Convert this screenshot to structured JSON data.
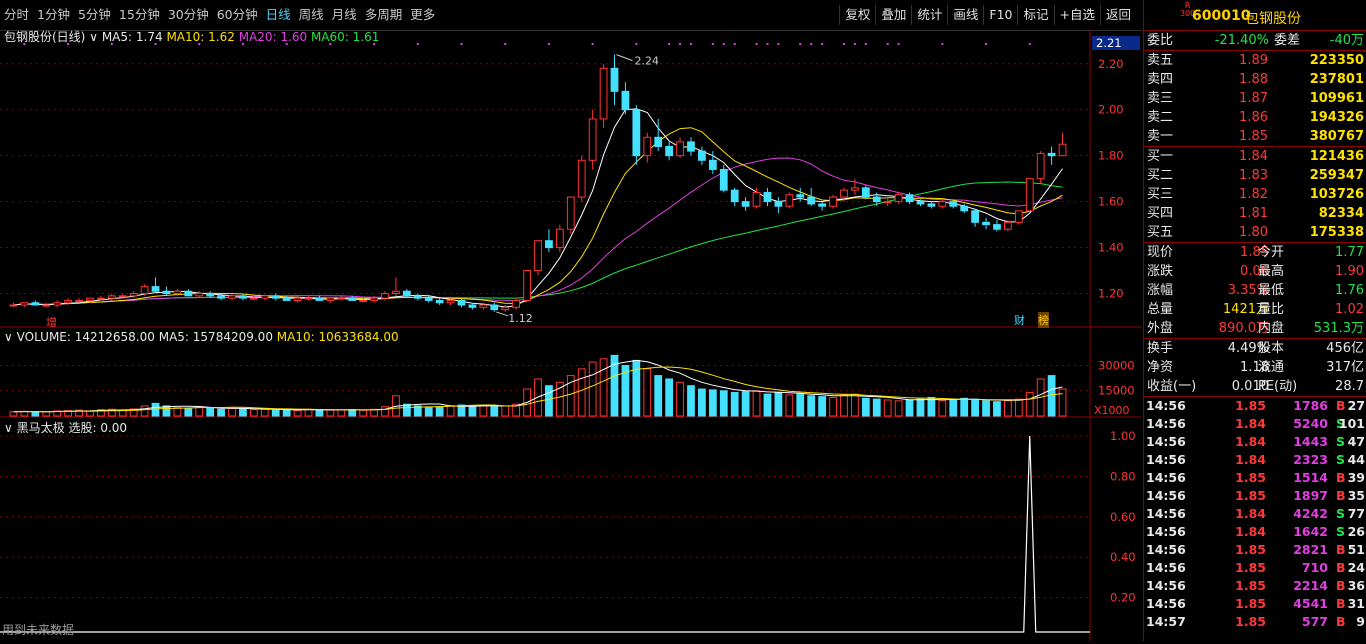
{
  "periods": [
    "分时",
    "1分钟",
    "5分钟",
    "15分钟",
    "30分钟",
    "60分钟",
    "日线",
    "周线",
    "月线",
    "多周期",
    "更多"
  ],
  "active_period": "日线",
  "tools": [
    "复权",
    "叠加",
    "统计",
    "画线",
    "F10",
    "标记",
    "+自选",
    "返回"
  ],
  "main_legend": {
    "title": "包钢股份(日线)",
    "ma5": "MA5: 1.74",
    "ma10": "MA10: 1.62",
    "ma20": "MA20: 1.60",
    "ma60": "MA60: 1.61"
  },
  "price_axis": {
    "top_label": "2.21",
    "ticks": [
      "2.20",
      "2.00",
      "1.80",
      "1.60",
      "1.40",
      "1.20"
    ],
    "high_note": "2.24",
    "low_note": "1.12"
  },
  "volume_legend": {
    "title": "VOLUME: 14212658.00",
    "ma5": "MA5: 15784209.00",
    "ma10": "MA10: 10633684.00"
  },
  "volume_axis": {
    "ticks": [
      "30000",
      "15000"
    ],
    "unit": "X1000"
  },
  "indicator_legend": {
    "title": "黑马太极",
    "value": "选股: 0.00"
  },
  "indicator_axis": [
    "1.00",
    "0.80",
    "0.60",
    "0.40",
    "0.20"
  ],
  "markers": {
    "zeng": "增",
    "cai": "财",
    "bang": "榜"
  },
  "footer_note": "用到未来数据",
  "colors": {
    "up": "#ff3333",
    "down": "#44e0ff",
    "ma5": "#ffffff",
    "ma10": "#ffe100",
    "ma20": "#e23ee2",
    "ma60": "#22e24a",
    "grid": "#8b0000"
  },
  "chart_data": {
    "type": "candlestick",
    "ohlc": [
      [
        1.15,
        1.16,
        1.14,
        1.15
      ],
      [
        1.15,
        1.16,
        1.14,
        1.16
      ],
      [
        1.16,
        1.17,
        1.15,
        1.15
      ],
      [
        1.15,
        1.16,
        1.14,
        1.15
      ],
      [
        1.15,
        1.17,
        1.14,
        1.16
      ],
      [
        1.16,
        1.18,
        1.15,
        1.17
      ],
      [
        1.17,
        1.18,
        1.16,
        1.17
      ],
      [
        1.17,
        1.18,
        1.16,
        1.18
      ],
      [
        1.18,
        1.19,
        1.17,
        1.18
      ],
      [
        1.18,
        1.2,
        1.17,
        1.19
      ],
      [
        1.19,
        1.2,
        1.18,
        1.19
      ],
      [
        1.19,
        1.21,
        1.18,
        1.2
      ],
      [
        1.2,
        1.24,
        1.19,
        1.23
      ],
      [
        1.23,
        1.27,
        1.21,
        1.21
      ],
      [
        1.21,
        1.23,
        1.19,
        1.2
      ],
      [
        1.2,
        1.22,
        1.19,
        1.21
      ],
      [
        1.21,
        1.22,
        1.19,
        1.19
      ],
      [
        1.19,
        1.21,
        1.18,
        1.2
      ],
      [
        1.2,
        1.21,
        1.18,
        1.19
      ],
      [
        1.19,
        1.2,
        1.17,
        1.18
      ],
      [
        1.18,
        1.2,
        1.17,
        1.19
      ],
      [
        1.19,
        1.2,
        1.17,
        1.18
      ],
      [
        1.18,
        1.19,
        1.17,
        1.18
      ],
      [
        1.18,
        1.19,
        1.17,
        1.19
      ],
      [
        1.19,
        1.2,
        1.17,
        1.18
      ],
      [
        1.18,
        1.19,
        1.17,
        1.17
      ],
      [
        1.17,
        1.19,
        1.16,
        1.18
      ],
      [
        1.18,
        1.19,
        1.17,
        1.18
      ],
      [
        1.18,
        1.19,
        1.17,
        1.17
      ],
      [
        1.17,
        1.18,
        1.16,
        1.18
      ],
      [
        1.18,
        1.19,
        1.17,
        1.18
      ],
      [
        1.18,
        1.19,
        1.17,
        1.17
      ],
      [
        1.17,
        1.18,
        1.16,
        1.17
      ],
      [
        1.17,
        1.19,
        1.16,
        1.18
      ],
      [
        1.18,
        1.21,
        1.17,
        1.2
      ],
      [
        1.2,
        1.27,
        1.19,
        1.21
      ],
      [
        1.21,
        1.22,
        1.18,
        1.19
      ],
      [
        1.19,
        1.2,
        1.17,
        1.18
      ],
      [
        1.18,
        1.19,
        1.16,
        1.17
      ],
      [
        1.17,
        1.18,
        1.15,
        1.16
      ],
      [
        1.16,
        1.18,
        1.15,
        1.17
      ],
      [
        1.17,
        1.18,
        1.14,
        1.15
      ],
      [
        1.15,
        1.16,
        1.13,
        1.14
      ],
      [
        1.14,
        1.16,
        1.13,
        1.15
      ],
      [
        1.15,
        1.16,
        1.12,
        1.13
      ],
      [
        1.13,
        1.15,
        1.12,
        1.14
      ],
      [
        1.14,
        1.18,
        1.13,
        1.17
      ],
      [
        1.17,
        1.3,
        1.17,
        1.3
      ],
      [
        1.3,
        1.43,
        1.28,
        1.43
      ],
      [
        1.43,
        1.48,
        1.38,
        1.4
      ],
      [
        1.4,
        1.5,
        1.38,
        1.48
      ],
      [
        1.48,
        1.62,
        1.46,
        1.62
      ],
      [
        1.62,
        1.8,
        1.6,
        1.78
      ],
      [
        1.78,
        2.0,
        1.74,
        1.96
      ],
      [
        1.96,
        2.2,
        1.92,
        2.18
      ],
      [
        2.18,
        2.24,
        2.02,
        2.08
      ],
      [
        2.08,
        2.12,
        1.98,
        2.0
      ],
      [
        2.0,
        2.02,
        1.76,
        1.8
      ],
      [
        1.8,
        1.9,
        1.77,
        1.88
      ],
      [
        1.88,
        1.96,
        1.82,
        1.84
      ],
      [
        1.84,
        1.86,
        1.78,
        1.8
      ],
      [
        1.8,
        1.88,
        1.79,
        1.86
      ],
      [
        1.86,
        1.88,
        1.8,
        1.82
      ],
      [
        1.82,
        1.84,
        1.76,
        1.78
      ],
      [
        1.78,
        1.82,
        1.72,
        1.74
      ],
      [
        1.74,
        1.76,
        1.64,
        1.65
      ],
      [
        1.65,
        1.66,
        1.58,
        1.6
      ],
      [
        1.6,
        1.62,
        1.56,
        1.58
      ],
      [
        1.58,
        1.66,
        1.57,
        1.64
      ],
      [
        1.64,
        1.66,
        1.58,
        1.6
      ],
      [
        1.6,
        1.62,
        1.55,
        1.58
      ],
      [
        1.58,
        1.64,
        1.57,
        1.63
      ],
      [
        1.63,
        1.66,
        1.6,
        1.62
      ],
      [
        1.62,
        1.66,
        1.58,
        1.59
      ],
      [
        1.59,
        1.6,
        1.56,
        1.58
      ],
      [
        1.58,
        1.63,
        1.57,
        1.62
      ],
      [
        1.62,
        1.66,
        1.6,
        1.65
      ],
      [
        1.65,
        1.7,
        1.63,
        1.66
      ],
      [
        1.66,
        1.67,
        1.61,
        1.62
      ],
      [
        1.62,
        1.64,
        1.58,
        1.6
      ],
      [
        1.6,
        1.62,
        1.58,
        1.6
      ],
      [
        1.6,
        1.64,
        1.59,
        1.63
      ],
      [
        1.63,
        1.64,
        1.59,
        1.6
      ],
      [
        1.6,
        1.61,
        1.58,
        1.59
      ],
      [
        1.59,
        1.6,
        1.57,
        1.58
      ],
      [
        1.58,
        1.61,
        1.57,
        1.6
      ],
      [
        1.6,
        1.61,
        1.57,
        1.58
      ],
      [
        1.58,
        1.59,
        1.55,
        1.56
      ],
      [
        1.56,
        1.57,
        1.49,
        1.51
      ],
      [
        1.51,
        1.53,
        1.48,
        1.5
      ],
      [
        1.5,
        1.52,
        1.47,
        1.48
      ],
      [
        1.48,
        1.52,
        1.47,
        1.51
      ],
      [
        1.51,
        1.56,
        1.5,
        1.56
      ],
      [
        1.56,
        1.7,
        1.56,
        1.7
      ],
      [
        1.7,
        1.82,
        1.68,
        1.81
      ],
      [
        1.81,
        1.84,
        1.76,
        1.8
      ],
      [
        1.8,
        1.9,
        1.8,
        1.85
      ]
    ],
    "volume": [
      2.5,
      2.8,
      2.6,
      2.4,
      3.0,
      3.2,
      3.5,
      3.0,
      3.8,
      4.0,
      3.5,
      4.2,
      6.0,
      7.5,
      6.0,
      5.0,
      4.5,
      5.2,
      4.8,
      4.0,
      4.5,
      4.2,
      3.8,
      4.0,
      3.5,
      3.6,
      3.2,
      4.0,
      3.8,
      3.5,
      3.6,
      3.8,
      3.4,
      4.0,
      5.5,
      12.0,
      7.0,
      6.0,
      5.0,
      5.5,
      6.2,
      6.5,
      5.8,
      6.0,
      5.5,
      6.0,
      7.0,
      16.0,
      22.0,
      18.0,
      20.0,
      24.0,
      28.0,
      32.0,
      34.0,
      36.0,
      30.0,
      33.0,
      28.0,
      24.0,
      22.0,
      20.0,
      18.0,
      16.0,
      15.5,
      15.0,
      14.0,
      14.5,
      15.0,
      13.0,
      14.0,
      12.5,
      13.0,
      12.0,
      11.5,
      11.0,
      12.5,
      13.0,
      10.5,
      10.0,
      9.5,
      9.0,
      9.5,
      10.0,
      11.0,
      9.0,
      9.5,
      10.5,
      10.0,
      9.0,
      8.5,
      9.0,
      10.0,
      14.0,
      22.0,
      24.0,
      16.0
    ],
    "indicator_peak_index": 93,
    "ylim": [
      1.05,
      2.26
    ],
    "volume_max": 38000
  },
  "quote": {
    "code": "600010",
    "name": "包钢股份",
    "rflag_top": "R",
    "rflag_bottom": "300",
    "weibi_label": "委比",
    "weibi": "-21.40%",
    "weicha_label": "委差",
    "weicha": "-40万",
    "sells": [
      {
        "label": "卖五",
        "price": "1.89",
        "vol": "223350"
      },
      {
        "label": "卖四",
        "price": "1.88",
        "vol": "237801"
      },
      {
        "label": "卖三",
        "price": "1.87",
        "vol": "109961"
      },
      {
        "label": "卖二",
        "price": "1.86",
        "vol": "194326"
      },
      {
        "label": "卖一",
        "price": "1.85",
        "vol": "380767"
      }
    ],
    "buys": [
      {
        "label": "买一",
        "price": "1.84",
        "vol": "121436"
      },
      {
        "label": "买二",
        "price": "1.83",
        "vol": "259347"
      },
      {
        "label": "买三",
        "price": "1.82",
        "vol": "103726"
      },
      {
        "label": "买四",
        "price": "1.81",
        "vol": "82334"
      },
      {
        "label": "买五",
        "price": "1.80",
        "vol": "175338"
      }
    ],
    "stats": [
      {
        "l1": "现价",
        "v1": "1.85",
        "c1": "red",
        "l2": "今开",
        "v2": "1.77",
        "c2": "grn"
      },
      {
        "l1": "涨跌",
        "v1": "0.06",
        "c1": "red",
        "l2": "最高",
        "v2": "1.90",
        "c2": "red"
      },
      {
        "l1": "涨幅",
        "v1": "3.35%",
        "c1": "red",
        "l2": "最低",
        "v2": "1.76",
        "c2": "grn"
      },
      {
        "l1": "总量",
        "v1": "1421万",
        "c1": "yel",
        "l2": "量比",
        "v2": "1.02",
        "c2": "red"
      },
      {
        "l1": "外盘",
        "v1": "890.0万",
        "c1": "red",
        "l2": "内盘",
        "v2": "531.3万",
        "c2": "grn"
      }
    ],
    "stats2": [
      {
        "l1": "换手",
        "v1": "4.49%",
        "l2": "股本",
        "v2": "456亿"
      },
      {
        "l1": "净资",
        "v1": "1.18",
        "l2": "流通",
        "v2": "317亿"
      },
      {
        "l1": "收益(一)",
        "v1": "0.010",
        "l2": "PE(动)",
        "v2": "28.7"
      }
    ],
    "ticks": [
      {
        "t": "14:56",
        "p": "1.85",
        "v": "1786",
        "s": "B",
        "n": "27"
      },
      {
        "t": "14:56",
        "p": "1.84",
        "v": "5240",
        "s": "S",
        "n": "101"
      },
      {
        "t": "14:56",
        "p": "1.84",
        "v": "1443",
        "s": "S",
        "n": "47"
      },
      {
        "t": "14:56",
        "p": "1.84",
        "v": "2323",
        "s": "S",
        "n": "44"
      },
      {
        "t": "14:56",
        "p": "1.85",
        "v": "1514",
        "s": "B",
        "n": "39"
      },
      {
        "t": "14:56",
        "p": "1.85",
        "v": "1897",
        "s": "B",
        "n": "35"
      },
      {
        "t": "14:56",
        "p": "1.84",
        "v": "4242",
        "s": "S",
        "n": "77"
      },
      {
        "t": "14:56",
        "p": "1.84",
        "v": "1642",
        "s": "S",
        "n": "26"
      },
      {
        "t": "14:56",
        "p": "1.85",
        "v": "2821",
        "s": "B",
        "n": "51"
      },
      {
        "t": "14:56",
        "p": "1.85",
        "v": "710",
        "s": "B",
        "n": "24"
      },
      {
        "t": "14:56",
        "p": "1.85",
        "v": "2214",
        "s": "B",
        "n": "36"
      },
      {
        "t": "14:56",
        "p": "1.85",
        "v": "4541",
        "s": "B",
        "n": "31"
      },
      {
        "t": "14:57",
        "p": "1.85",
        "v": "577",
        "s": "B",
        "n": "9"
      }
    ]
  }
}
